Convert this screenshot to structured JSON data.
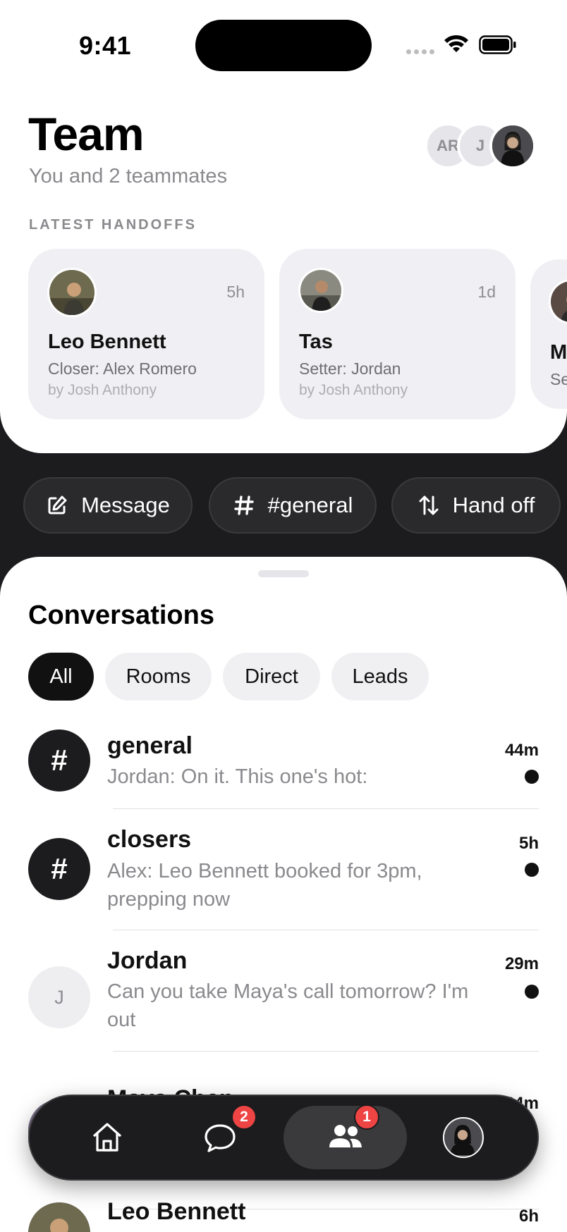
{
  "status_bar": {
    "time": "9:41"
  },
  "header": {
    "title": "Team",
    "subtitle": "You and 2 teammates",
    "member_avatars": [
      "AR",
      "J",
      "photo"
    ]
  },
  "handoffs": {
    "label": "LATEST HANDOFFS",
    "items": [
      {
        "name": "Leo Bennett",
        "role": "Closer: Alex Romero",
        "by": "by Josh Anthony",
        "time": "5h"
      },
      {
        "name": "Tas",
        "role": "Setter: Jordan",
        "by": "by Josh Anthony",
        "time": "1d"
      },
      {
        "name": "M",
        "role": "Se",
        "by": "",
        "time": ""
      }
    ]
  },
  "actions": [
    {
      "label": "Message",
      "icon": "compose-icon"
    },
    {
      "label": "#general",
      "icon": "hash-icon"
    },
    {
      "label": "Hand off",
      "icon": "swap-arrows-icon"
    }
  ],
  "conversations": {
    "title": "Conversations",
    "filters": [
      "All",
      "Rooms",
      "Direct",
      "Leads"
    ],
    "active_filter": "All",
    "rows": [
      {
        "name": "general",
        "preview": "Jordan: On it. This one's hot:",
        "time": "44m",
        "unread": true,
        "avatar": "#"
      },
      {
        "name": "closers",
        "preview": "Alex: Leo Bennett booked for 3pm, prepping now",
        "time": "5h",
        "unread": true,
        "avatar": "#"
      },
      {
        "name": "Jordan",
        "preview": "Can you take Maya's call tomorrow? I'm out",
        "time": "29m",
        "unread": true,
        "avatar": "J"
      },
      {
        "name": "Maya Chen",
        "preview": "",
        "time": "34m",
        "unread": true,
        "avatar": "photo"
      },
      {
        "name": "Leo Bennett",
        "preview": "",
        "time": "6h",
        "unread": false,
        "avatar": "photo"
      }
    ]
  },
  "tabbar": {
    "items": [
      {
        "name": "home",
        "icon": "home-icon",
        "badge": ""
      },
      {
        "name": "messages",
        "icon": "chat-bubble-icon",
        "badge": "2"
      },
      {
        "name": "team",
        "icon": "people-icon",
        "badge": "1"
      },
      {
        "name": "profile",
        "icon": "avatar",
        "badge": ""
      }
    ]
  },
  "colors": {
    "accent": "#111111",
    "badge": "#ef4444",
    "dark_bg": "#1c1c1e"
  }
}
